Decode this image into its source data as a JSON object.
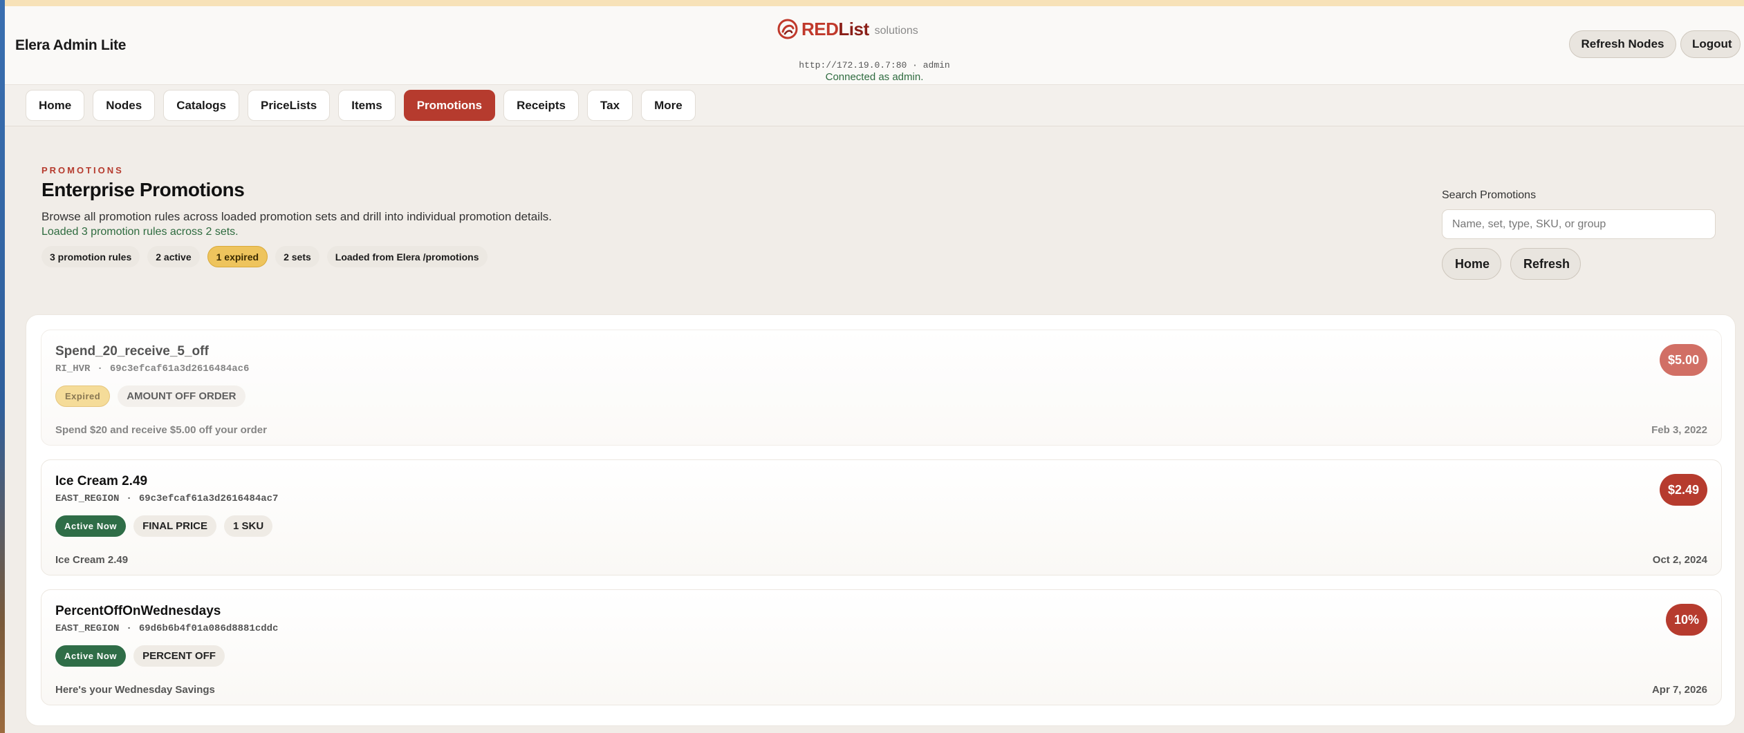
{
  "header": {
    "app_title": "Elera Admin Lite",
    "brand": {
      "name_red": "RED",
      "name_dark": "List",
      "sub": "solutions"
    },
    "connection_url": "http://172.19.0.7:80 · admin",
    "connection_status": "Connected as admin.",
    "refresh_nodes_label": "Refresh Nodes",
    "logout_label": "Logout"
  },
  "nav": {
    "items": [
      "Home",
      "Nodes",
      "Catalogs",
      "PriceLists",
      "Items",
      "Promotions",
      "Receipts",
      "Tax",
      "More"
    ],
    "active": "Promotions"
  },
  "hero": {
    "eyebrow": "PROMOTIONS",
    "title": "Enterprise Promotions",
    "description": "Browse all promotion rules across loaded promotion sets and drill into individual promotion details.",
    "load_status": "Loaded 3 promotion rules across 2 sets.",
    "chips": [
      "3 promotion rules",
      "2 active",
      "1 expired",
      "2 sets",
      "Loaded from Elera /promotions"
    ],
    "search_label": "Search Promotions",
    "search_placeholder": "Name, set, type, SKU, or group",
    "home_label": "Home",
    "refresh_label": "Refresh"
  },
  "promotions": [
    {
      "name": "Spend_20_receive_5_off",
      "set": "RI_HVR",
      "id": "69c3efcaf61a3d2616484ac6",
      "status": "Expired",
      "tags": [
        "AMOUNT OFF ORDER"
      ],
      "description": "Spend $20 and receive $5.00 off your order",
      "date": "Feb 3, 2022",
      "value": "$5.00"
    },
    {
      "name": "Ice Cream 2.49",
      "set": "EAST_REGION",
      "id": "69c3efcaf61a3d2616484ac7",
      "status": "Active Now",
      "tags": [
        "FINAL PRICE",
        "1 SKU"
      ],
      "description": "Ice Cream 2.49",
      "date": "Oct 2, 2024",
      "value": "$2.49"
    },
    {
      "name": "PercentOffOnWednesdays",
      "set": "EAST_REGION",
      "id": "69d6b6b4f01a086d8881cddc",
      "status": "Active Now",
      "tags": [
        "PERCENT OFF"
      ],
      "description": "Here's your Wednesday Savings",
      "date": "Apr 7, 2026",
      "value": "10%"
    }
  ],
  "colors": {
    "accent": "#b63b2e",
    "active_status": "#2f6d47",
    "expired_status": "#f2cf73",
    "success_text": "#2e6b3f"
  }
}
